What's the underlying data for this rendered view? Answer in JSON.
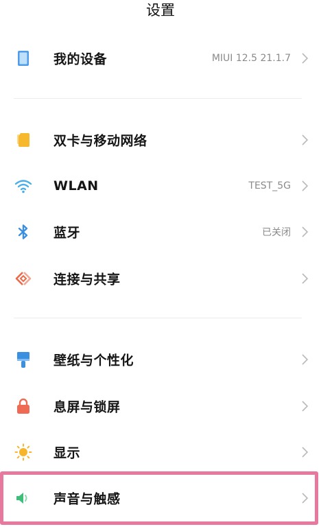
{
  "header": {
    "title": "设置"
  },
  "rows": [
    {
      "label": "我的设备",
      "value": "MIUI 12.5 21.1.7",
      "icon": "device-icon"
    },
    {
      "label": "双卡与移动网络",
      "value": "",
      "icon": "sim-card-icon"
    },
    {
      "label": "WLAN",
      "value": "TEST_5G",
      "icon": "wifi-icon"
    },
    {
      "label": "蓝牙",
      "value": "已关闭",
      "icon": "bluetooth-icon"
    },
    {
      "label": "连接与共享",
      "value": "",
      "icon": "share-connection-icon"
    },
    {
      "label": "壁纸与个性化",
      "value": "",
      "icon": "wallpaper-brush-icon"
    },
    {
      "label": "息屏与锁屏",
      "value": "",
      "icon": "lock-icon"
    },
    {
      "label": "显示",
      "value": "",
      "icon": "sun-display-icon"
    },
    {
      "label": "声音与触感",
      "value": "",
      "icon": "speaker-sound-icon"
    }
  ],
  "highlight": {
    "row": "声音与触感",
    "color": "#e8799e"
  }
}
